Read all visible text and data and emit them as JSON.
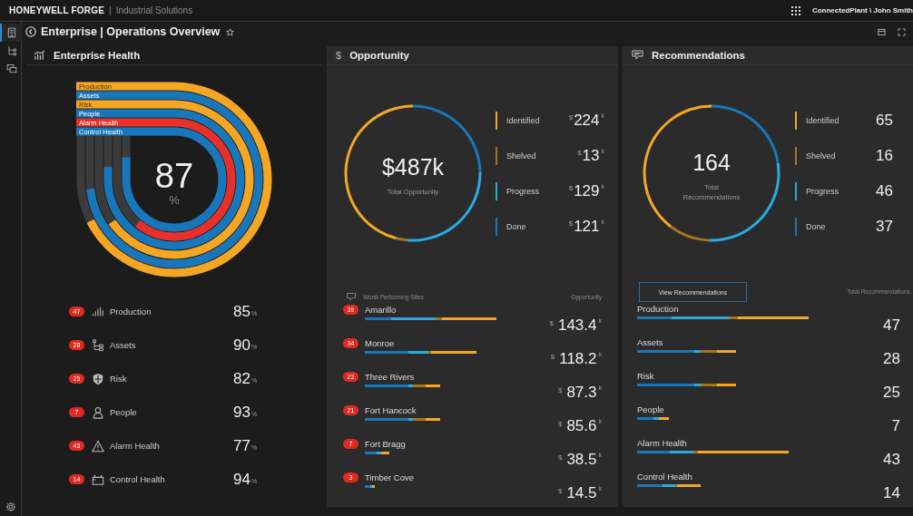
{
  "header": {
    "brand": "HONEYWELL FORGE",
    "separator": "|",
    "product": "Industrial Solutions",
    "account": "ConnectedPlant \\ John Smith"
  },
  "sidebar": {
    "items": [
      {
        "kind": "dashboard",
        "selected": true
      },
      {
        "kind": "hierarchy",
        "selected": false
      },
      {
        "kind": "windows",
        "selected": false
      }
    ]
  },
  "page": {
    "title": "Enterprise | Operations Overview"
  },
  "health": {
    "title": "Enterprise Health",
    "total": "87",
    "unit": "%",
    "rings": [
      {
        "label": "Production",
        "color": "#f5a623"
      },
      {
        "label": "Assets",
        "color": "#1877bb"
      },
      {
        "label": "Risk",
        "color": "#f5a623"
      },
      {
        "label": "People",
        "color": "#1877bb"
      },
      {
        "label": "Alarm Health",
        "color": "#e8302a"
      },
      {
        "label": "Control Health",
        "color": "#1877bb"
      }
    ],
    "items": [
      {
        "label": "Production",
        "badge": "47",
        "kind": "bars",
        "value": "85",
        "unit": "%"
      },
      {
        "label": "Assets",
        "badge": "28",
        "kind": "tree",
        "value": "90",
        "unit": "%"
      },
      {
        "label": "Risk",
        "badge": "25",
        "kind": "shield",
        "value": "82",
        "unit": "%"
      },
      {
        "label": "People",
        "badge": "7",
        "kind": "person",
        "value": "93",
        "unit": "%"
      },
      {
        "label": "Alarm Health",
        "badge": "43",
        "kind": "warning",
        "value": "77",
        "unit": "%"
      },
      {
        "label": "Control Health",
        "badge": "14",
        "kind": "control",
        "value": "94",
        "unit": "%"
      }
    ]
  },
  "opportunity": {
    "icon": "$",
    "title": "Opportunity",
    "total": "$487k",
    "caption": "Total Opportunity",
    "chart_data": {
      "type": "donut",
      "categories": [
        "Identified",
        "Shelved",
        "Progress",
        "Done"
      ],
      "values": [
        46.0,
        2.7,
        26.5,
        24.8
      ]
    },
    "legend": [
      {
        "currency": "$",
        "value": "224",
        "unit": "k",
        "color": "#f5a623"
      },
      {
        "currency": "$",
        "value": "13",
        "unit": "k",
        "color": "#a8741a"
      },
      {
        "currency": "$",
        "value": "129",
        "unit": "k",
        "color": "#29abe2"
      },
      {
        "currency": "$",
        "value": "121",
        "unit": "k",
        "color": "#1877bb"
      }
    ],
    "sites": {
      "title": "Worst Performing Sites",
      "column": "Opportunity",
      "rows": [
        {
          "name": "Amarillo",
          "badge": "39",
          "currency": "$",
          "value": "143.4",
          "unit": "k"
        },
        {
          "name": "Monroe",
          "badge": "34",
          "currency": "$",
          "value": "118.2",
          "unit": "k"
        },
        {
          "name": "Three Rivers",
          "badge": "23",
          "currency": "$",
          "value": "87.3",
          "unit": "k"
        },
        {
          "name": "Fort Hancock",
          "badge": "21",
          "currency": "$",
          "value": "85.6",
          "unit": "k"
        },
        {
          "name": "Fort Bragg",
          "badge": "7",
          "currency": "$",
          "value": "38.5",
          "unit": "k"
        },
        {
          "name": "Timber Cove",
          "badge": "3",
          "currency": "$",
          "value": "14.5",
          "unit": "k"
        }
      ]
    }
  },
  "recommendations": {
    "title": "Recommendations",
    "total": "164",
    "caption": "Total Recommendations",
    "chart_data": {
      "type": "donut",
      "categories": [
        "Identified",
        "Shelved",
        "Progress",
        "Done"
      ],
      "values": [
        39.6,
        9.8,
        28.0,
        22.6
      ]
    },
    "legend": [
      {
        "value": "65",
        "color": "#f5a623"
      },
      {
        "value": "16",
        "color": "#a8741a"
      },
      {
        "value": "46",
        "color": "#29abe2"
      },
      {
        "value": "37",
        "color": "#1877bb"
      }
    ],
    "button": "View Recommendations",
    "column": "Total Recommendations",
    "rows": [
      {
        "name": "Production",
        "value": "47"
      },
      {
        "name": "Assets",
        "value": "28"
      },
      {
        "name": "Risk",
        "value": "25"
      },
      {
        "name": "People",
        "value": "7"
      },
      {
        "name": "Alarm Health",
        "value": "43"
      },
      {
        "name": "Control Health",
        "value": "14"
      }
    ]
  }
}
